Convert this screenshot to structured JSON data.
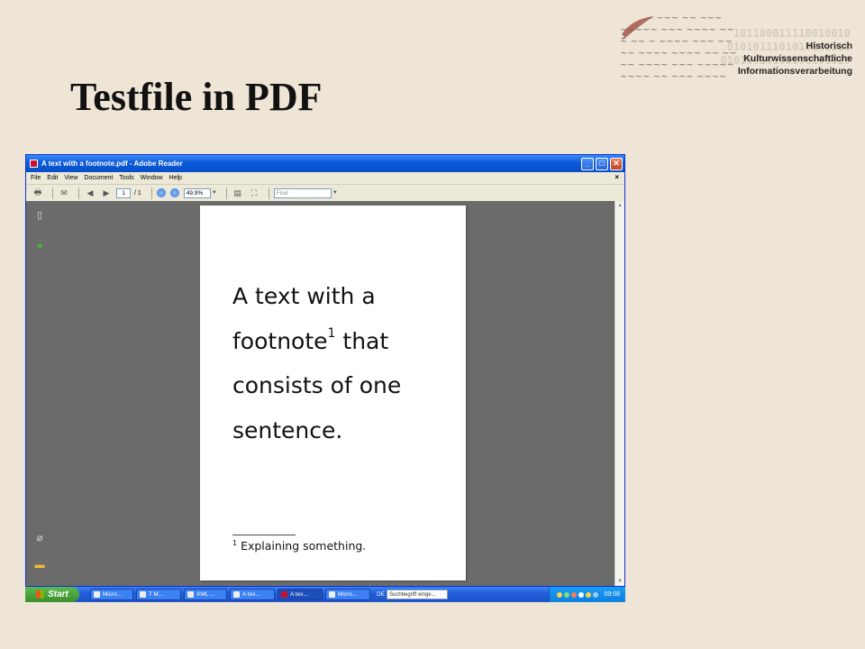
{
  "slide": {
    "title": "Testfile in PDF"
  },
  "logo": {
    "lines": [
      "Historisch",
      "Kulturwissenschaftliche",
      "Informationsverarbeitung"
    ],
    "binary": [
      "101100011110010010",
      "0101011101010101111",
      "01010010100100101010"
    ]
  },
  "window": {
    "title": "A text with a footnote.pdf - Adobe Reader",
    "controls": {
      "minimize": "_",
      "maximize": "□",
      "close": "✕"
    },
    "menu": [
      "File",
      "Edit",
      "View",
      "Document",
      "Tools",
      "Window",
      "Help"
    ],
    "menu_close": "×",
    "toolbar": {
      "page_current": "1",
      "page_total": "/ 1",
      "zoom": "49,9%",
      "find_placeholder": "Find"
    }
  },
  "document": {
    "body_parts": [
      "A text with a footnote",
      "1",
      " that consists of one sentence."
    ],
    "footnote_number": "1",
    "footnote_text": " Explaining something."
  },
  "taskbar": {
    "start_label": "Start",
    "tasks": [
      "Micro...",
      "7 M...",
      "XML ...",
      "A tex...",
      "A tex...",
      "Micro..."
    ],
    "language": "DE",
    "search_placeholder": "Suchbegriff einge...",
    "clock": "09:08"
  },
  "colors": {
    "background": "#efe5d6",
    "titlebar": "#0a5ad8",
    "doc_background": "#6b6b6b",
    "taskbar": "#245edb",
    "start": "#3a8e2e"
  }
}
